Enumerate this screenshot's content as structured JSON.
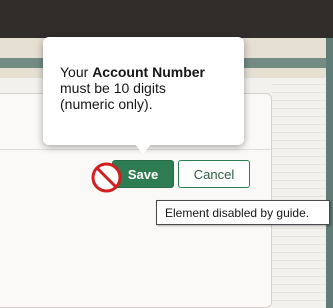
{
  "tooltip": {
    "line_prefix": "Your ",
    "field_name": "Account Number",
    "line_rest_1": "must be 10 digits",
    "line_rest_2": "(numeric only)."
  },
  "buttons": {
    "save_label": "Save",
    "cancel_label": "Cancel"
  },
  "disabled_tooltip": "Element disabled by guide.",
  "icons": {
    "blocked": "no-entry-icon"
  },
  "colors": {
    "save_bg": "#2e7d52",
    "blocked_red": "#d11f1f"
  }
}
